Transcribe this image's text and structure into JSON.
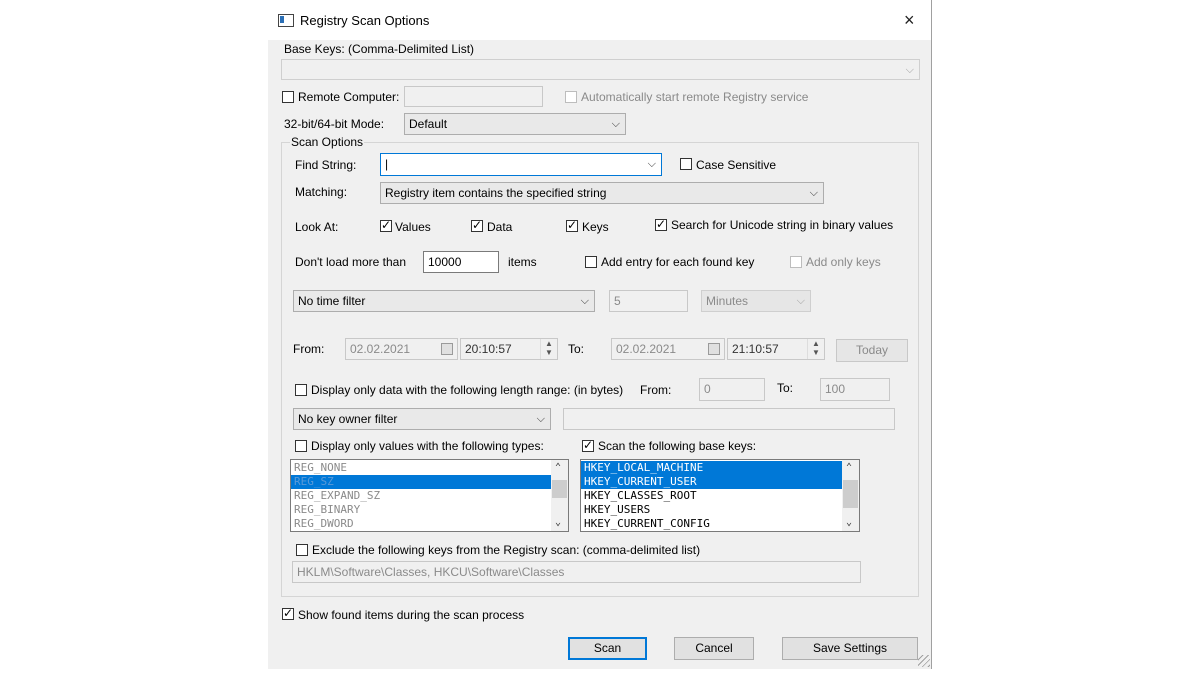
{
  "window": {
    "title": "Registry Scan Options",
    "close_icon": "×"
  },
  "base_keys": {
    "label": "Base Keys:  (Comma-Delimited List)",
    "value": ""
  },
  "remote": {
    "label": "Remote Computer:",
    "value": "",
    "auto_start_label": "Automatically start remote Registry service"
  },
  "mode": {
    "label": "32-bit/64-bit Mode:",
    "value": "Default"
  },
  "scan_options": {
    "group_label": "Scan Options",
    "find_label": "Find String:",
    "find_value": "|",
    "case_sensitive_label": "Case Sensitive",
    "matching_label": "Matching:",
    "matching_value": "Registry item contains the specified string",
    "look_at_label": "Look At:",
    "values_label": "Values",
    "data_label": "Data",
    "keys_label": "Keys",
    "unicode_label": "Search for Unicode string in binary values",
    "dont_load_label": "Don't load more than",
    "dont_load_value": "10000",
    "items_label": "items",
    "add_entry_label": "Add entry for each found key",
    "add_only_keys_label": "Add only keys",
    "time_filter_value": "No time filter",
    "time_amount": "5",
    "time_unit": "Minutes",
    "from_label": "From:",
    "from_date": "02.02.2021",
    "from_time": "20:10:57",
    "to_label": "To:",
    "to_date": "02.02.2021",
    "to_time": "21:10:57",
    "today_label": "Today",
    "length_label": "Display only data with the following length range: (in bytes)",
    "length_from_label": "From:",
    "length_from": "0",
    "length_to_label": "To:",
    "length_to": "100",
    "owner_filter_value": "No key owner filter",
    "owner_value": "",
    "types_label": "Display only values with the following types:",
    "types": [
      "REG_NONE",
      "REG_SZ",
      "REG_EXPAND_SZ",
      "REG_BINARY",
      "REG_DWORD"
    ],
    "base_keys_label": "Scan the following base keys:",
    "base_keys_list": [
      "HKEY_LOCAL_MACHINE",
      "HKEY_CURRENT_USER",
      "HKEY_CLASSES_ROOT",
      "HKEY_USERS",
      "HKEY_CURRENT_CONFIG"
    ],
    "exclude_label": "Exclude the following keys from the Registry scan: (comma-delimited list)",
    "exclude_value": "HKLM\\Software\\Classes, HKCU\\Software\\Classes"
  },
  "show_found_label": "Show found items during the scan process",
  "buttons": {
    "scan": "Scan",
    "cancel": "Cancel",
    "save": "Save Settings"
  },
  "glyphs": {
    "check": "✓",
    "chevron": "⌵",
    "up": "⌃",
    "down": "⌄",
    "spin_up": "▲",
    "spin_down": "▼"
  },
  "colors": {
    "selection": "#0078d7",
    "dialog_bg": "#f0f0f0",
    "focus_border": "#0078d7"
  }
}
